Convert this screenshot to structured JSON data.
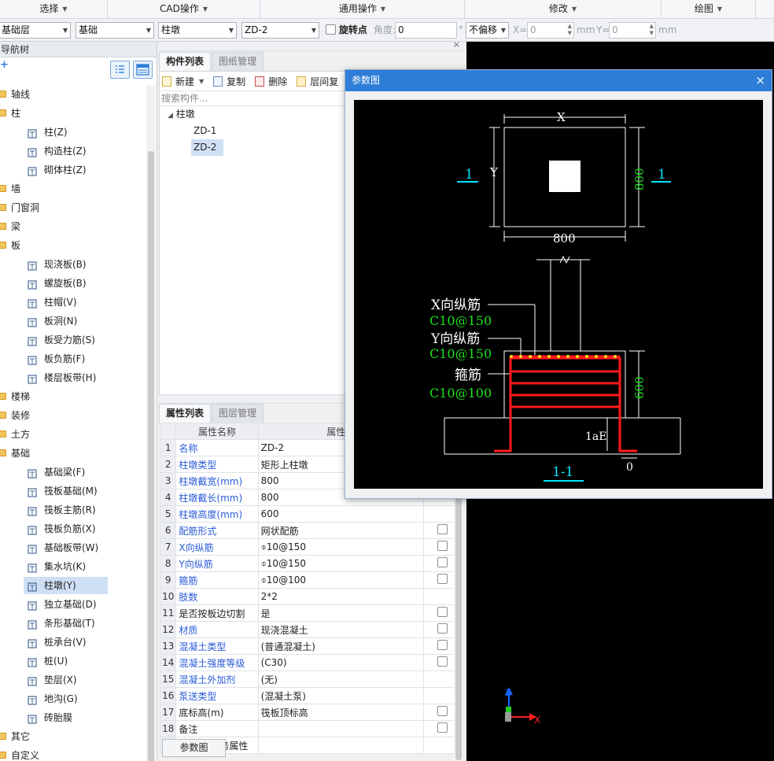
{
  "menubar": [
    "选择",
    "CAD操作",
    "通用操作",
    "修改",
    "绘图"
  ],
  "toolbar": {
    "floor": "基础层",
    "category": "基础",
    "type": "柱墩",
    "name": "ZD-2",
    "rotate_label": "旋转点",
    "angle_label": "角度:",
    "angle_value": "0",
    "degree": "°",
    "offset": "不偏移",
    "x_label": "X=",
    "x_value": "0",
    "mm1": "mm",
    "y_label": "Y=",
    "y_value": "0",
    "mm2": "mm"
  },
  "nav": {
    "title": "导航树",
    "items": [
      {
        "label": "轴线",
        "level": 0
      },
      {
        "label": "柱",
        "level": 0
      },
      {
        "label": "柱(Z)",
        "level": 1
      },
      {
        "label": "构造柱(Z)",
        "level": 1
      },
      {
        "label": "砌体柱(Z)",
        "level": 1
      },
      {
        "label": "墙",
        "level": 0
      },
      {
        "label": "门窗洞",
        "level": 0
      },
      {
        "label": "梁",
        "level": 0
      },
      {
        "label": "板",
        "level": 0
      },
      {
        "label": "现浇板(B)",
        "level": 1
      },
      {
        "label": "螺旋板(B)",
        "level": 1
      },
      {
        "label": "柱帽(V)",
        "level": 1
      },
      {
        "label": "板洞(N)",
        "level": 1
      },
      {
        "label": "板受力筋(S)",
        "level": 1
      },
      {
        "label": "板负筋(F)",
        "level": 1
      },
      {
        "label": "楼层板带(H)",
        "level": 1
      },
      {
        "label": "楼梯",
        "level": 0
      },
      {
        "label": "装修",
        "level": 0
      },
      {
        "label": "土方",
        "level": 0
      },
      {
        "label": "基础",
        "level": 0
      },
      {
        "label": "基础梁(F)",
        "level": 1
      },
      {
        "label": "筏板基础(M)",
        "level": 1
      },
      {
        "label": "筏板主筋(R)",
        "level": 1
      },
      {
        "label": "筏板负筋(X)",
        "level": 1
      },
      {
        "label": "基础板带(W)",
        "level": 1
      },
      {
        "label": "集水坑(K)",
        "level": 1
      },
      {
        "label": "柱墩(Y)",
        "level": 1,
        "selected": true
      },
      {
        "label": "独立基础(D)",
        "level": 1
      },
      {
        "label": "条形基础(T)",
        "level": 1
      },
      {
        "label": "桩承台(V)",
        "level": 1
      },
      {
        "label": "桩(U)",
        "level": 1
      },
      {
        "label": "垫层(X)",
        "level": 1
      },
      {
        "label": "地沟(G)",
        "level": 1
      },
      {
        "label": "砖胎膜",
        "level": 1
      },
      {
        "label": "其它",
        "level": 0
      },
      {
        "label": "自定义",
        "level": 0
      }
    ]
  },
  "components": {
    "tab_active": "构件列表",
    "tab_other": "图纸管理",
    "btn_new": "新建",
    "btn_copy": "复制",
    "btn_delete": "删除",
    "btn_floor": "层间复",
    "search_placeholder": "搜索构件...",
    "group": "柱墩",
    "items": [
      "ZD-1",
      "ZD-2"
    ]
  },
  "props": {
    "tab_active": "属性列表",
    "tab_other": "图层管理",
    "col_name": "属性名称",
    "col_value": "属性值",
    "rows": [
      {
        "n": "1",
        "k": "名称",
        "v": "ZD-2",
        "blue": true,
        "c": false
      },
      {
        "n": "2",
        "k": "柱墩类型",
        "v": "矩形上柱墩",
        "blue": true,
        "c": false
      },
      {
        "n": "3",
        "k": "柱墩截宽(mm)",
        "v": "800",
        "blue": true,
        "c": false
      },
      {
        "n": "4",
        "k": "柱墩截长(mm)",
        "v": "800",
        "blue": true,
        "c": false
      },
      {
        "n": "5",
        "k": "柱墩高度(mm)",
        "v": "600",
        "blue": true,
        "c": false
      },
      {
        "n": "6",
        "k": "配筋形式",
        "v": "网状配筋",
        "blue": true,
        "c": true
      },
      {
        "n": "7",
        "k": "X向纵筋",
        "v": "⌽10@150",
        "blue": true,
        "c": true
      },
      {
        "n": "8",
        "k": "Y向纵筋",
        "v": "⌽10@150",
        "blue": true,
        "c": true
      },
      {
        "n": "9",
        "k": "箍筋",
        "v": "⌽10@100",
        "blue": true,
        "c": true
      },
      {
        "n": "10",
        "k": "肢数",
        "v": "2*2",
        "blue": true,
        "c": false
      },
      {
        "n": "11",
        "k": "是否按板边切割",
        "v": "是",
        "blue": false,
        "c": true
      },
      {
        "n": "12",
        "k": "材质",
        "v": "现浇混凝土",
        "blue": true,
        "c": true
      },
      {
        "n": "13",
        "k": "混凝土类型",
        "v": "(普通混凝土)",
        "blue": true,
        "c": true
      },
      {
        "n": "14",
        "k": "混凝土强度等级",
        "v": "(C30)",
        "blue": true,
        "c": true
      },
      {
        "n": "15",
        "k": "混凝土外加剂",
        "v": "(无)",
        "blue": true,
        "c": false
      },
      {
        "n": "16",
        "k": "泵送类型",
        "v": "(混凝土泵)",
        "blue": true,
        "c": false
      },
      {
        "n": "17",
        "k": "底标高(m)",
        "v": "筏板顶标高",
        "blue": false,
        "c": true
      },
      {
        "n": "18",
        "k": "备注",
        "v": "",
        "blue": false,
        "c": true
      },
      {
        "n": "19",
        "k": "钢筋业务属性",
        "v": "",
        "blue": false,
        "c": false,
        "expand": true
      }
    ],
    "param_button": "参数图"
  },
  "dialog": {
    "title": "参数图",
    "close": "×",
    "drawing": {
      "x_label": "X",
      "y_label": "Y",
      "dim_width": "800",
      "dim_length": "800",
      "section_mark": "1",
      "x_bar_label": "X向纵筋",
      "x_bar_value": "C10@150",
      "y_bar_label": "Y向纵筋",
      "y_bar_value": "C10@150",
      "stirrup_label": "箍筋",
      "stirrup_value": "C10@100",
      "dim_height": "600",
      "lae": "1aE",
      "zero": "0",
      "section_title": "1-1"
    }
  },
  "axis": {
    "z": "Z",
    "x": "X"
  },
  "colors": {
    "dialog_header": "#2e7ed8",
    "rebar": "#ff1a1a",
    "dim_green": "#1ee01e",
    "cyan": "#00e5ff",
    "blue_text": "#2a5bd7"
  }
}
